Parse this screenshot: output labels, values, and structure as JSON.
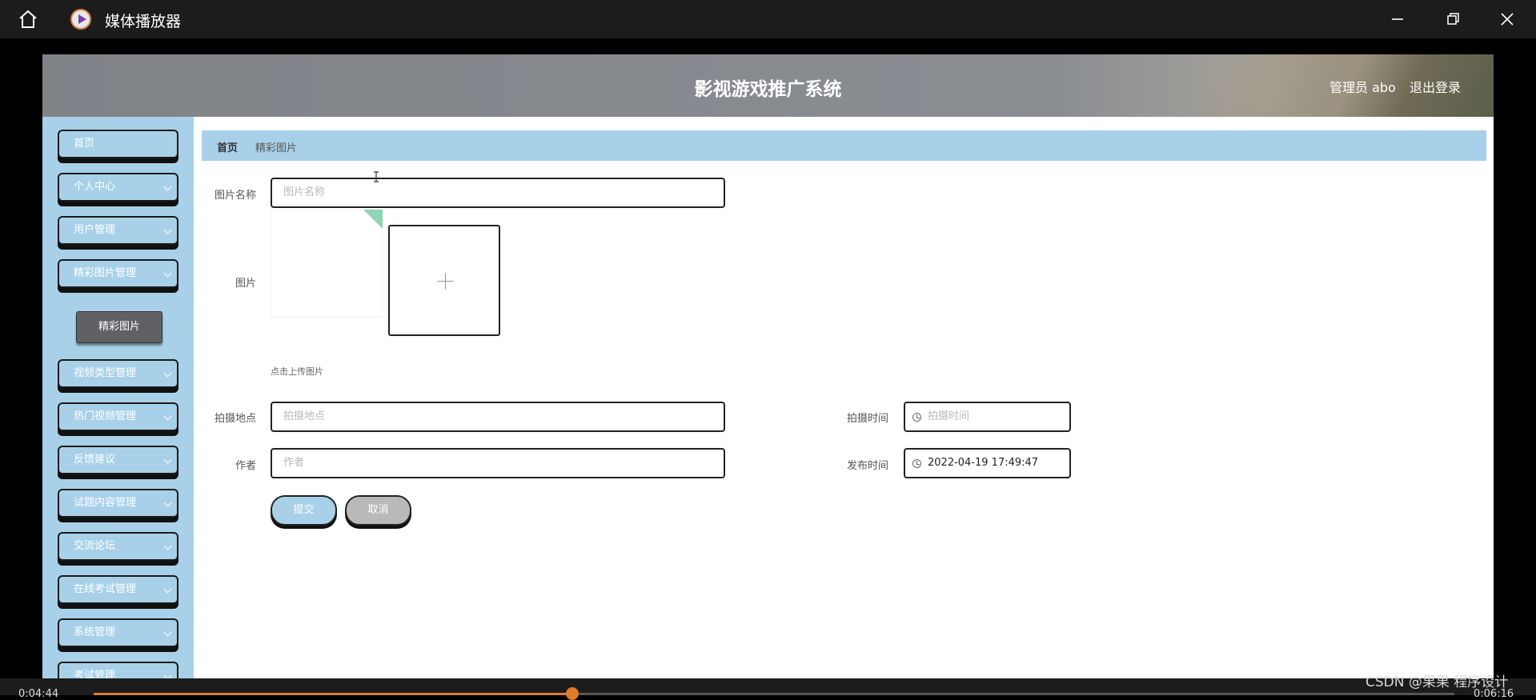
{
  "player": {
    "title": "媒体播放器",
    "time_elapsed": "0:04:44",
    "time_total": "0:06:16",
    "progress": 0.352,
    "watermark": "CSDN @果果 程序设计"
  },
  "site": {
    "title": "影视游戏推广系统",
    "user_label": "管理员 abo",
    "logout_label": "退出登录"
  },
  "sidebar": {
    "items": [
      {
        "label": "首页",
        "has_arrow": false
      },
      {
        "label": "个人中心",
        "has_arrow": true
      },
      {
        "label": "用户管理",
        "has_arrow": true
      },
      {
        "label": "精彩图片管理",
        "has_arrow": true
      },
      {
        "label": "视频类型管理",
        "has_arrow": true
      },
      {
        "label": "热门视频管理",
        "has_arrow": true
      },
      {
        "label": "反馈建议",
        "has_arrow": true
      },
      {
        "label": "试题内容管理",
        "has_arrow": true
      },
      {
        "label": "交流论坛",
        "has_arrow": true
      },
      {
        "label": "在线考试管理",
        "has_arrow": true
      },
      {
        "label": "系统管理",
        "has_arrow": true
      },
      {
        "label": "考试管理",
        "has_arrow": true
      }
    ],
    "sub_item": "精彩图片"
  },
  "breadcrumb": {
    "home": "首页",
    "current": "精彩图片"
  },
  "form": {
    "name_label": "图片名称",
    "name_placeholder": "图片名称",
    "image_label": "图片",
    "upload_tip": "点击上传图片",
    "location_label": "拍摄地点",
    "location_placeholder": "拍摄地点",
    "shoot_time_label": "拍摄时间",
    "shoot_time_placeholder": "拍摄时间",
    "author_label": "作者",
    "author_placeholder": "作者",
    "publish_time_label": "发布时间",
    "publish_time_value": "2022-04-19 17:49:47",
    "submit_label": "提交",
    "cancel_label": "取消"
  },
  "colors": {
    "accent": "#a8d1e9",
    "progress": "#e07b2a",
    "header": "#808489"
  }
}
